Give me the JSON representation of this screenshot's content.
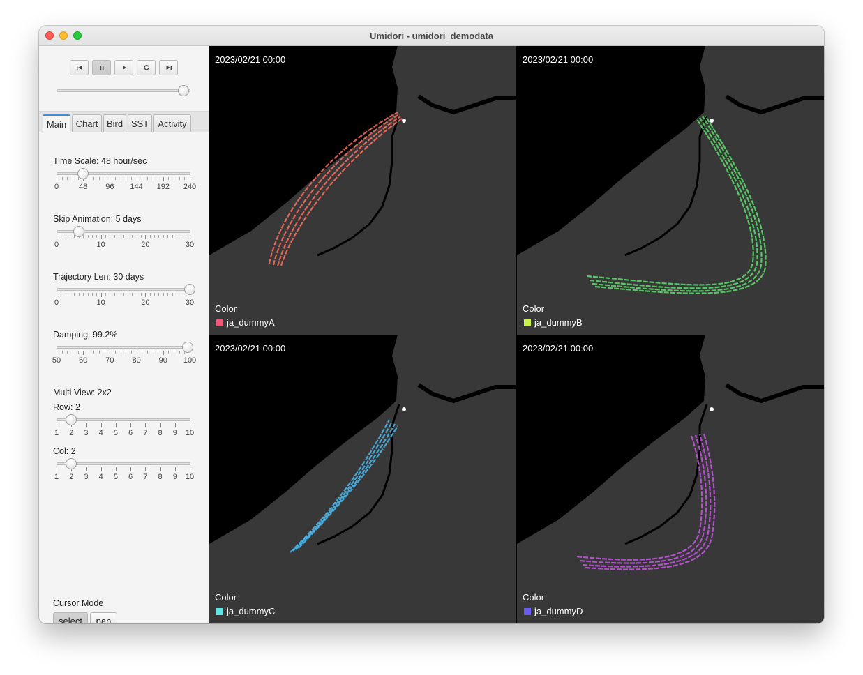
{
  "window": {
    "title": "Umidori - umidori_demodata"
  },
  "playback": {
    "buttons": [
      {
        "name": "skip-to-start-button",
        "icon": "skip-back-icon"
      },
      {
        "name": "pause-button",
        "icon": "pause-icon",
        "active": true
      },
      {
        "name": "play-button",
        "icon": "play-icon"
      },
      {
        "name": "reload-button",
        "icon": "reload-icon"
      },
      {
        "name": "skip-to-end-button",
        "icon": "skip-forward-icon"
      }
    ],
    "progress": 0.95
  },
  "tabs": [
    "Main",
    "Chart",
    "Bird",
    "SST",
    "Activity"
  ],
  "active_tab": "Main",
  "controls": {
    "time_scale": {
      "label": "Time Scale: 48 hour/sec",
      "value": 48,
      "min": 0,
      "max": 240,
      "ticks": [
        "0",
        "48",
        "96",
        "144",
        "192",
        "240"
      ]
    },
    "skip_animation": {
      "label": "Skip Animation: 5 days",
      "value": 5,
      "min": 0,
      "max": 30,
      "ticks": [
        "0",
        "10",
        "20",
        "30"
      ]
    },
    "trajectory_len": {
      "label": "Trajectory Len: 30 days",
      "value": 30,
      "min": 0,
      "max": 30,
      "ticks": [
        "0",
        "10",
        "20",
        "30"
      ]
    },
    "damping": {
      "label": "Damping: 99.2%",
      "value": 99.2,
      "min": 50,
      "max": 100,
      "ticks": [
        "50",
        "60",
        "70",
        "80",
        "90",
        "100"
      ]
    },
    "multi_view": {
      "label": "Multi View: 2x2"
    },
    "row": {
      "label": "Row: 2",
      "value": 2,
      "min": 1,
      "max": 10,
      "ticks": [
        "1",
        "2",
        "3",
        "4",
        "5",
        "6",
        "7",
        "8",
        "9",
        "10"
      ]
    },
    "col": {
      "label": "Col: 2",
      "value": 2,
      "min": 1,
      "max": 10,
      "ticks": [
        "1",
        "2",
        "3",
        "4",
        "5",
        "6",
        "7",
        "8",
        "9",
        "10"
      ]
    }
  },
  "cursor_mode": {
    "label": "Cursor Mode",
    "select": "select",
    "pan": "pan",
    "active": "select"
  },
  "panels": [
    {
      "time": "2023/02/21 00:00",
      "color_label": "Color",
      "legend": "ja_dummyA",
      "color": "#f0587a",
      "track_color": "#ff6f5e"
    },
    {
      "time": "2023/02/21 00:00",
      "color_label": "Color",
      "legend": "ja_dummyB",
      "color": "#c6f04a",
      "track_color": "#5ae06a"
    },
    {
      "time": "2023/02/21 00:00",
      "color_label": "Color",
      "legend": "ja_dummyC",
      "color": "#5ce6e6",
      "track_color": "#4ab8ee"
    },
    {
      "time": "2023/02/21 00:00",
      "color_label": "Color",
      "legend": "ja_dummyD",
      "color": "#6b5cf0",
      "track_color": "#c956e6"
    }
  ]
}
